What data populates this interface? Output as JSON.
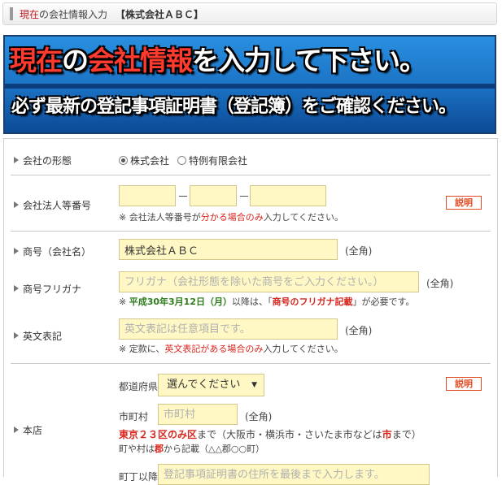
{
  "breadcrumb": {
    "current": "現在",
    "rest": "の会社情報入力",
    "company": "【株式会社ＡＢＣ】"
  },
  "banner": {
    "line1_red1": "現在",
    "line1_w1": "の",
    "line1_red2": "会社情報",
    "line1_w2": "を入力して下さい。",
    "line2": "必ず最新の登記事項証明書（登記簿）をご確認ください。"
  },
  "form": {
    "company_type": {
      "label": "会社の形態",
      "options": [
        "株式会社",
        "特例有限会社"
      ],
      "selected": "株式会社"
    },
    "corp_number": {
      "label": "会社法人等番号",
      "values": [
        "",
        "",
        ""
      ],
      "help_button": "説明",
      "note_prefix": "※ 会社法人等番号が",
      "note_red": "分かる場合のみ",
      "note_suffix": "入力してください。"
    },
    "trade_name": {
      "label": "商号（会社名）",
      "value": "株式会社ＡＢＣ",
      "suffix": "(全角)"
    },
    "trade_name_kana": {
      "label": "商号フリガナ",
      "placeholder": "フリガナ（会社形態を除いた商号をご入力ください。）",
      "suffix": "(全角)",
      "note_prefix": "※ ",
      "note_green": "平成30年3月12日（月）",
      "note_mid": "以降は、「",
      "note_red": "商号のフリガナ記載",
      "note_suffix": "」が必要です。"
    },
    "english_name": {
      "label": "英文表記",
      "placeholder": "英文表記は任意項目です。",
      "suffix": "(全角)",
      "note_prefix": "※ 定款に、",
      "note_red": "英文表記がある場合のみ",
      "note_suffix": "入力してください。"
    },
    "head_office": {
      "label": "本店",
      "pref_label": "都道府県",
      "pref_value": "選んでください",
      "help_button": "説明",
      "city_label": "市町村",
      "city_placeholder": "市町村",
      "city_suffix": "(全角)",
      "note1_red": "東京２３区のみ区",
      "note1_mid": "まで（大阪市・横浜市・さいたま市などは",
      "note1_red2": "市",
      "note1_suffix": "まで）",
      "note2_prefix": "町や村は",
      "note2_red": "郡",
      "note2_suffix": "から記載（△△郡○○町）",
      "street_label": "町丁以降",
      "street_placeholder": "登記事項証明書の住所を最後まで入力します。"
    }
  }
}
